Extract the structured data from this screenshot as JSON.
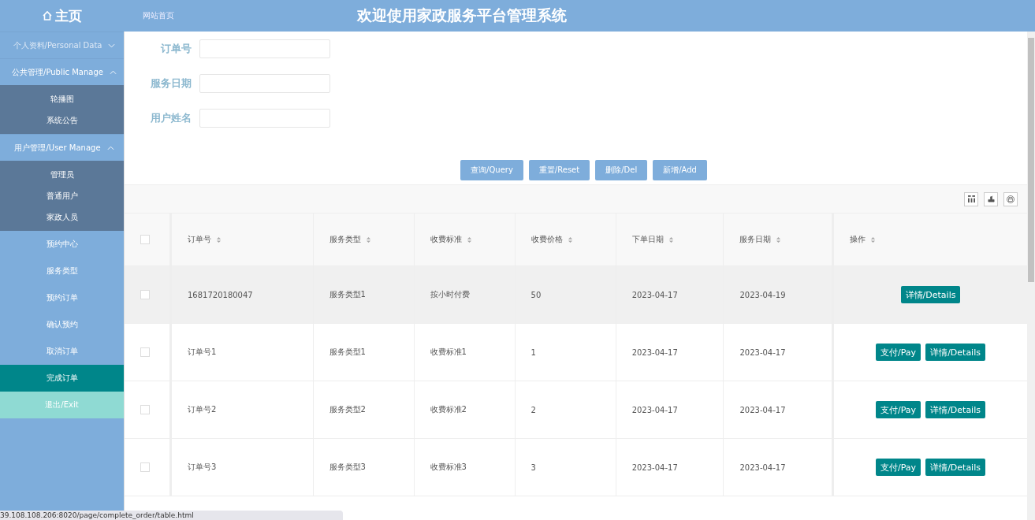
{
  "header": {
    "home": "主页",
    "breadcrumb": "网站首页",
    "title": "欢迎使用家政服务平台管理系统"
  },
  "sidebar": [
    {
      "kind": "group",
      "label": "个人资料/Personal Data",
      "expanded": false
    },
    {
      "kind": "group",
      "label": "公共管理/Public Manage",
      "expanded": true,
      "children": [
        {
          "label": "轮播图"
        },
        {
          "label": "系统公告"
        }
      ]
    },
    {
      "kind": "group",
      "label": "用户管理/User Manage",
      "expanded": true,
      "children": [
        {
          "label": "管理员"
        },
        {
          "label": "普通用户"
        },
        {
          "label": "家政人员"
        }
      ]
    },
    {
      "kind": "link",
      "label": "预约中心",
      "selected": false
    },
    {
      "kind": "link",
      "label": "服务类型",
      "selected": false
    },
    {
      "kind": "link",
      "label": "预约订单",
      "selected": false
    },
    {
      "kind": "link",
      "label": "确认预约",
      "selected": false
    },
    {
      "kind": "link",
      "label": "取消订单",
      "selected": false
    },
    {
      "kind": "link",
      "label": "完成订单",
      "selected": true
    },
    {
      "kind": "exit",
      "label": "退出/Exit"
    }
  ],
  "filters": [
    {
      "label": "订单号"
    },
    {
      "label": "服务日期"
    },
    {
      "label": "用户姓名"
    }
  ],
  "actions": [
    "查询/Query",
    "重置/Reset",
    "删除/Del",
    "新增/Add"
  ],
  "table": {
    "select_all": false,
    "columns": [
      "订单号",
      "服务类型",
      "收费标准",
      "收费价格",
      "下单日期",
      "服务日期",
      "操作"
    ],
    "rows": [
      {
        "checked": false,
        "hover": true,
        "cells": [
          "1681720180047",
          "服务类型1",
          "按小时付费",
          "50",
          "2023-04-17",
          "2023-04-19"
        ],
        "buttons": [
          "详情/Details"
        ]
      },
      {
        "checked": false,
        "hover": false,
        "cells": [
          "订单号1",
          "服务类型1",
          "收费标准1",
          "1",
          "2023-04-17",
          "2023-04-17"
        ],
        "buttons": [
          "支付/Pay",
          "详情/Details"
        ]
      },
      {
        "checked": false,
        "hover": false,
        "cells": [
          "订单号2",
          "服务类型2",
          "收费标准2",
          "2",
          "2023-04-17",
          "2023-04-17"
        ],
        "buttons": [
          "支付/Pay",
          "详情/Details"
        ]
      },
      {
        "checked": false,
        "hover": false,
        "cells": [
          "订单号3",
          "服务类型3",
          "收费标准3",
          "3",
          "2023-04-17",
          "2023-04-17"
        ],
        "buttons": [
          "支付/Pay",
          "详情/Details"
        ]
      }
    ]
  },
  "status_url": "39.108.108.206:8020/page/complete_order/table.html"
}
